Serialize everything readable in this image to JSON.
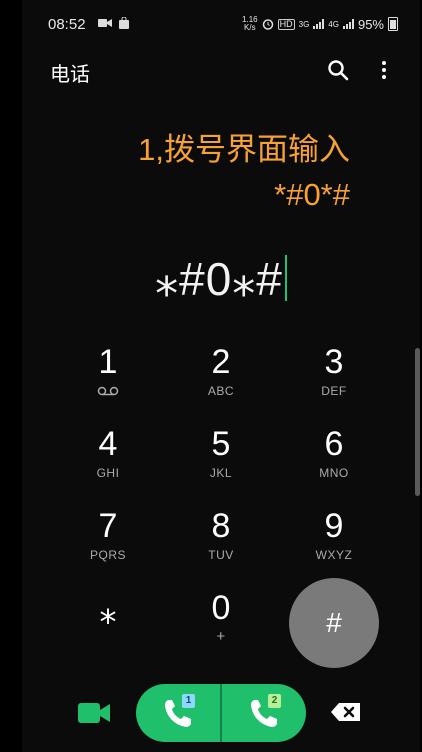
{
  "status_bar": {
    "time": "08:52",
    "net_speed_value": "1.16",
    "net_speed_unit": "K/s",
    "hd_label": "HD",
    "signal_1_label": "3G",
    "signal_2_label": "4G",
    "battery": "95%"
  },
  "app_bar": {
    "title": "电话"
  },
  "annotation": {
    "line1": "1,拨号界面输入",
    "line2": "*#0*#"
  },
  "dialer": {
    "number": "⁎#0⁎#",
    "keys": [
      {
        "digit": "1",
        "sub": ""
      },
      {
        "digit": "2",
        "sub": "ABC"
      },
      {
        "digit": "3",
        "sub": "DEF"
      },
      {
        "digit": "4",
        "sub": "GHI"
      },
      {
        "digit": "5",
        "sub": "JKL"
      },
      {
        "digit": "6",
        "sub": "MNO"
      },
      {
        "digit": "7",
        "sub": "PQRS"
      },
      {
        "digit": "8",
        "sub": "TUV"
      },
      {
        "digit": "9",
        "sub": "WXYZ"
      },
      {
        "digit": "⁎",
        "sub": ""
      },
      {
        "digit": "0",
        "sub": "+"
      },
      {
        "digit": "#",
        "sub": ""
      }
    ]
  },
  "bottom": {
    "sim1_label": "1",
    "sim2_label": "2"
  },
  "colors": {
    "accent_green": "#1fbf6c",
    "annotation_orange": "#f7a233",
    "hash_key_bg": "#7a7a7a"
  }
}
